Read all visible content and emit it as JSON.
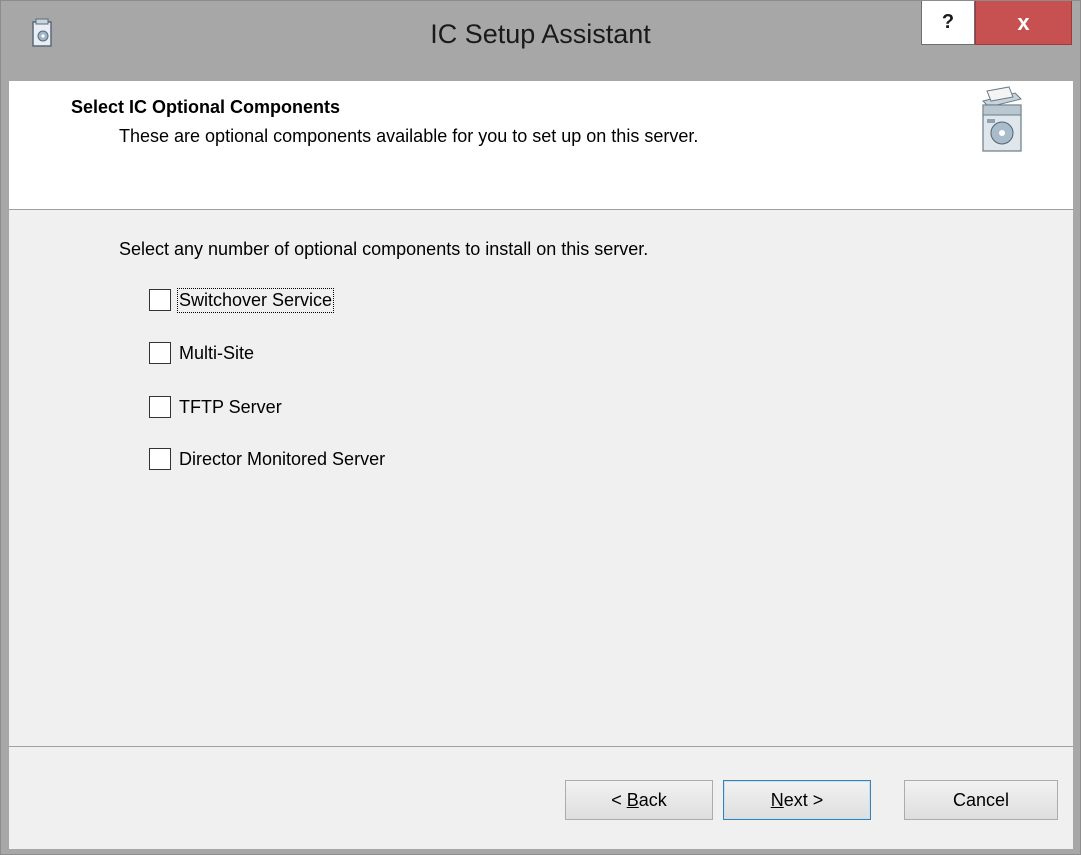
{
  "window": {
    "title": "IC Setup Assistant",
    "help_glyph": "?",
    "close_glyph": "x",
    "icon": "setup-app-icon"
  },
  "header": {
    "title": "Select IC Optional Components",
    "subtitle": "These are optional components available for you to set up on this server.",
    "icon": "software-box-icon"
  },
  "body": {
    "instruction": "Select any number of optional components to install on this server.",
    "components": [
      {
        "label": "Switchover Service",
        "checked": false,
        "focused": true
      },
      {
        "label": "Multi-Site",
        "checked": false
      },
      {
        "label": "TFTP Server",
        "checked": false
      },
      {
        "label": "Director Monitored Server",
        "checked": false
      }
    ]
  },
  "footer": {
    "back_prefix": "< ",
    "back_key": "B",
    "back_rest": "ack",
    "next_key": "N",
    "next_rest": "ext >",
    "cancel_label": "Cancel"
  },
  "colors": {
    "close_button": "#c75050",
    "title_bar": "#a7a7a7",
    "client_bg": "#f0f0f0",
    "default_button_border": "#3c7fb1"
  }
}
